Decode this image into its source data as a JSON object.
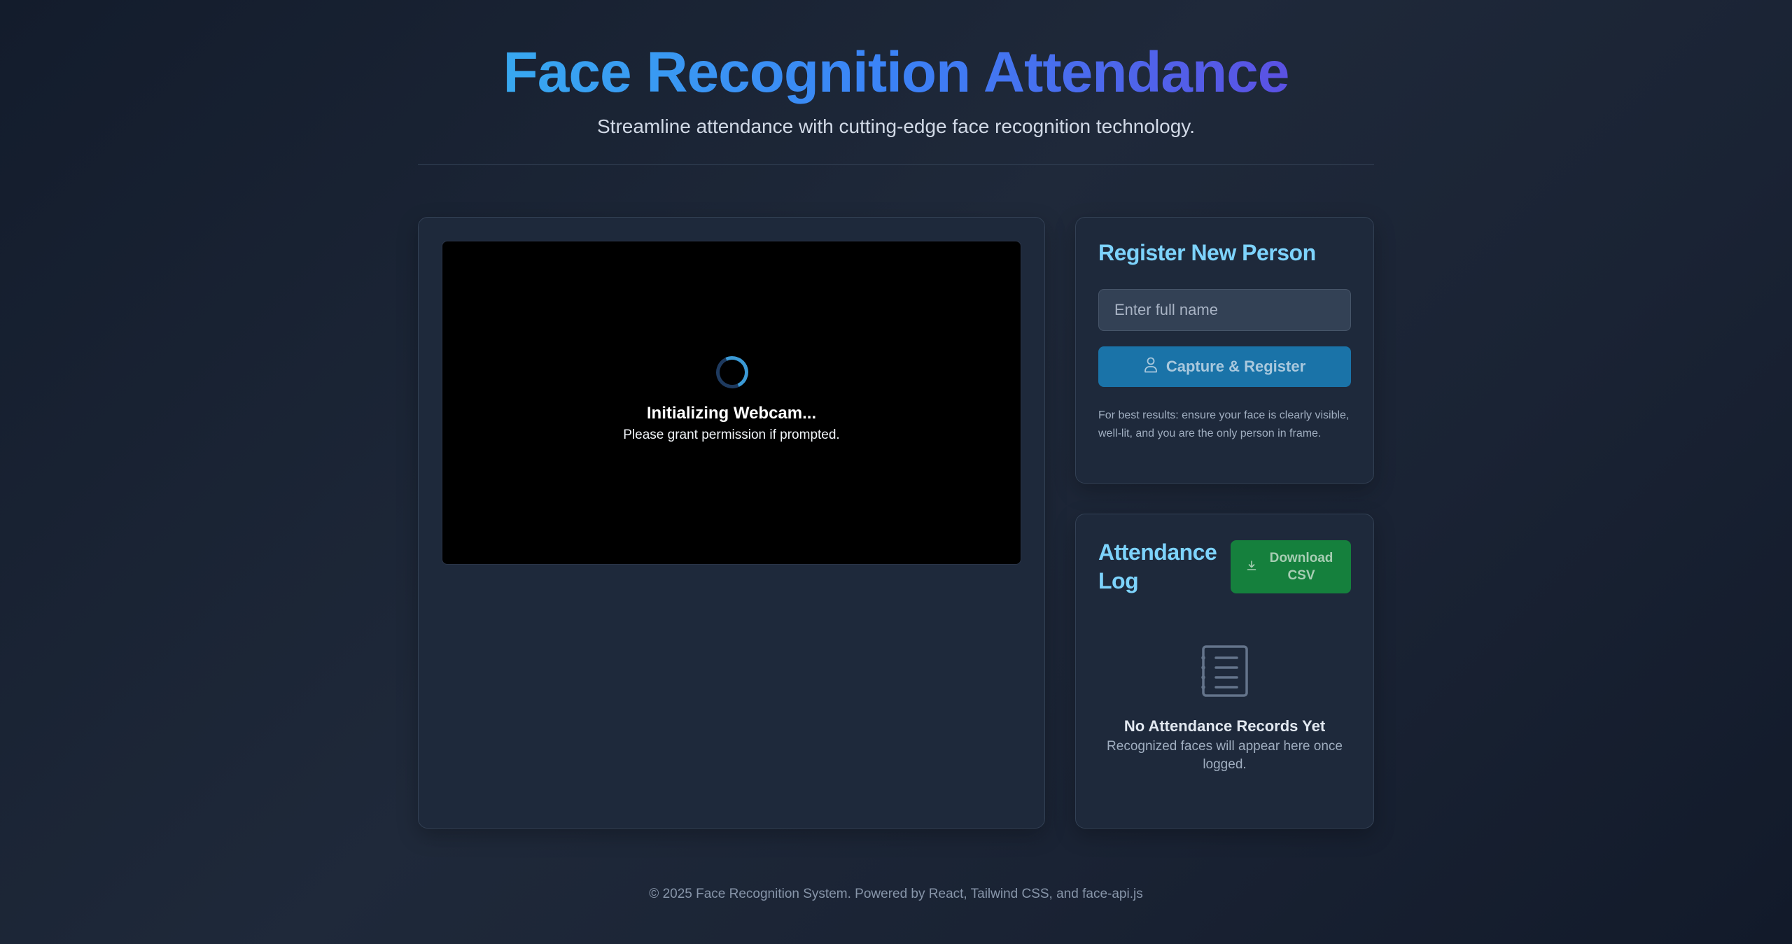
{
  "header": {
    "title": "Face Recognition Attendance",
    "subtitle": "Streamline attendance with cutting-edge face recognition technology."
  },
  "webcam": {
    "status": "Initializing Webcam...",
    "hint": "Please grant permission if prompted.",
    "spinner_icon": "loading-spinner-icon"
  },
  "register": {
    "title": "Register New Person",
    "name_placeholder": "Enter full name",
    "name_value": "",
    "capture_label": "Capture & Register",
    "capture_icon": "user-icon",
    "note": "For best results: ensure your face is clearly visible, well-lit, and you are the only person in frame."
  },
  "log": {
    "title": "Attendance Log",
    "download_label": "Download CSV",
    "download_icon": "download-icon",
    "empty_icon": "clipboard-list-icon",
    "empty_title": "No Attendance Records Yet",
    "empty_subtitle": "Recognized faces will appear here once logged."
  },
  "footer": {
    "text": "© 2025 Face Recognition System. Powered by React, Tailwind CSS, and face-api.js"
  },
  "colors": {
    "accent_title_start": "#38a8f0",
    "accent_title_end": "#5b51e3",
    "card_title": "#7dd3fc",
    "capture_button": "#1a73a8",
    "download_button": "#15803d",
    "background": "#1a2334"
  }
}
